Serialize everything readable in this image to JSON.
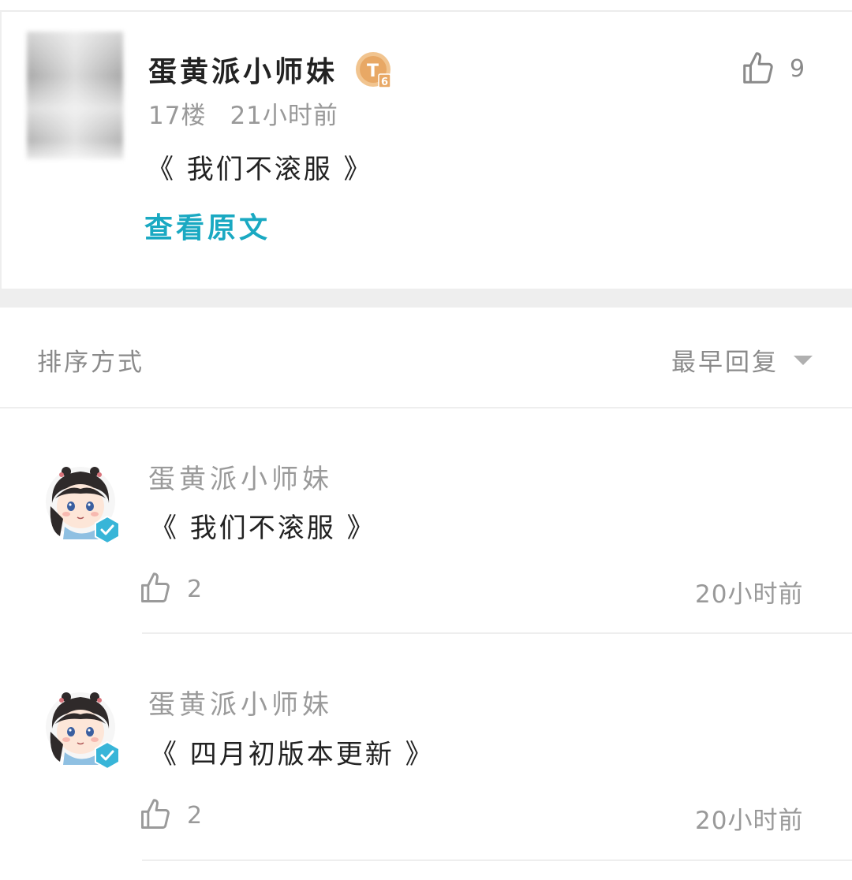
{
  "post": {
    "author": "蛋黄派小师妹",
    "level_badge": "T6",
    "floor": "17楼",
    "time": "21小时前",
    "content": "《 我们不滚服 》",
    "view_original": "查看原文",
    "likes": "9"
  },
  "sort": {
    "label": "排序方式",
    "value": "最早回复"
  },
  "replies": [
    {
      "author": "蛋黄派小师妹",
      "content": "《 我们不滚服 》",
      "likes": "2",
      "time": "20小时前"
    },
    {
      "author": "蛋黄派小师妹",
      "content": "《 四月初版本更新 》",
      "likes": "2",
      "time": "20小时前"
    }
  ],
  "colors": {
    "accent": "#1aa9c2",
    "badge_gold": "#e8b37a",
    "verified": "#38b5d8"
  },
  "icons": {
    "like": "thumbs-up-icon",
    "sort": "caret-down-icon",
    "verified": "verified-badge-icon",
    "level": "level-badge-icon"
  }
}
